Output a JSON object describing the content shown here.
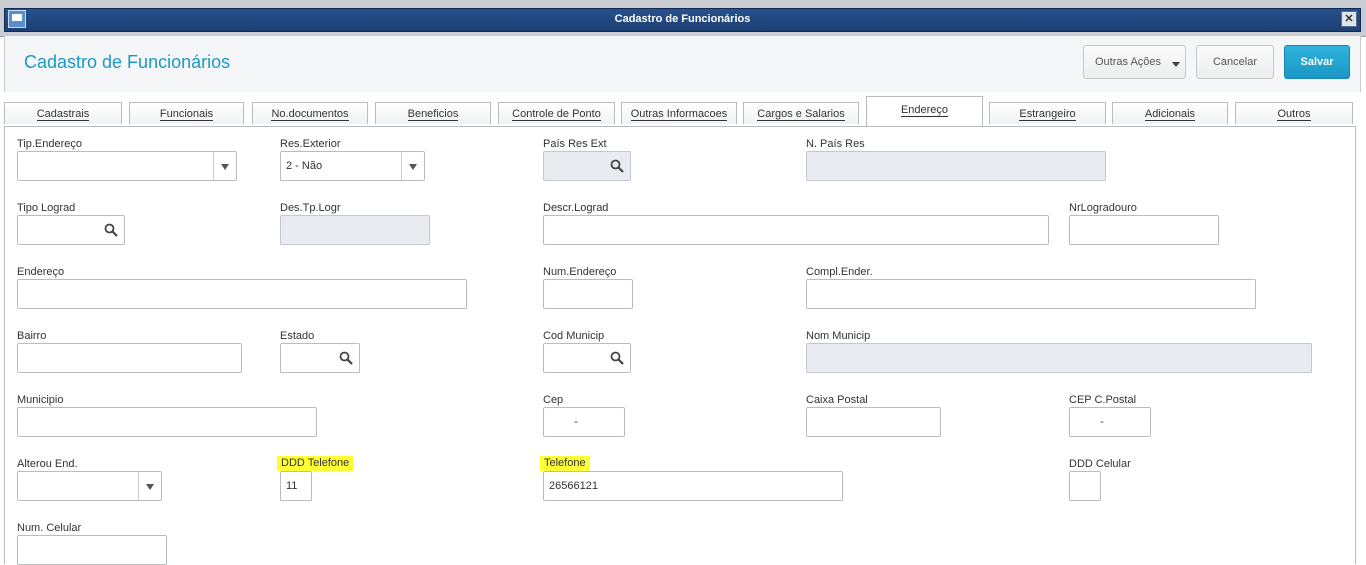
{
  "window": {
    "title": "Cadastro de Funcionários"
  },
  "header": {
    "title": "Cadastro de Funcionários",
    "outras_acoes": "Outras Ações",
    "cancelar": "Cancelar",
    "salvar": "Salvar"
  },
  "tabs": [
    "Cadastrais",
    "Funcionais",
    "No.documentos",
    "Beneficios",
    "Controle de Ponto",
    "Outras Informacoes",
    "Cargos e Salarios",
    "Endereço",
    "Estrangeiro",
    "Adicionais",
    "Outros"
  ],
  "active_tab": "Endereço",
  "form": {
    "tip_endereco": {
      "label": "Tip.Endereço",
      "value": ""
    },
    "res_exterior": {
      "label": "Res.Exterior",
      "value": "2 - Não"
    },
    "pais_res_ext": {
      "label": "País Res Ext",
      "value": ""
    },
    "n_pais_res": {
      "label": "N. País Res",
      "value": ""
    },
    "tipo_lograd": {
      "label": "Tipo Lograd",
      "value": ""
    },
    "des_tp_logr": {
      "label": "Des.Tp.Logr",
      "value": ""
    },
    "descr_lograd": {
      "label": "Descr.Lograd",
      "value": ""
    },
    "nr_logradouro": {
      "label": "NrLogradouro",
      "value": ""
    },
    "endereco": {
      "label": "Endereço",
      "value": ""
    },
    "num_endereco": {
      "label": "Num.Endereço",
      "value": ""
    },
    "compl_ender": {
      "label": "Compl.Ender.",
      "value": ""
    },
    "bairro": {
      "label": "Bairro",
      "value": ""
    },
    "estado": {
      "label": "Estado",
      "value": ""
    },
    "cod_municip": {
      "label": "Cod Municip",
      "value": ""
    },
    "nom_municip": {
      "label": "Nom Municip",
      "value": ""
    },
    "municipio": {
      "label": "Municipio",
      "value": ""
    },
    "cep": {
      "label": "Cep",
      "value": "-"
    },
    "caixa_postal": {
      "label": "Caixa Postal",
      "value": ""
    },
    "cep_c_postal": {
      "label": "CEP C.Postal",
      "value": "-"
    },
    "alterou_end": {
      "label": "Alterou End.",
      "value": ""
    },
    "ddd_telefone": {
      "label": "DDD Telefone",
      "value": "11"
    },
    "telefone": {
      "label": "Telefone",
      "value": "26566121"
    },
    "ddd_celular": {
      "label": "DDD Celular",
      "value": ""
    },
    "num_celular": {
      "label": "Num. Celular",
      "value": ""
    }
  },
  "colors": {
    "accent": "#1d98c6",
    "highlight": "#ffff33",
    "readonly": "#e9ebf0"
  },
  "icons": {
    "lookup": "search-icon",
    "dropdown": "chevron-down-icon"
  }
}
